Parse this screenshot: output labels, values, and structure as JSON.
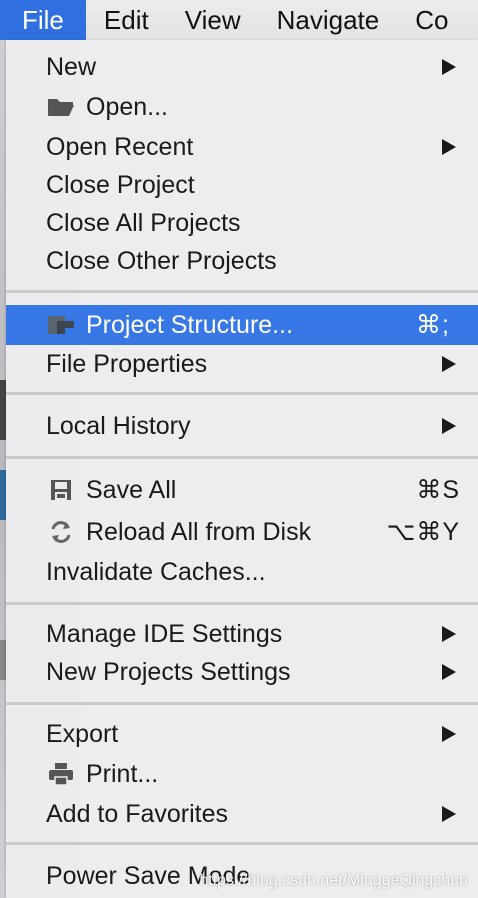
{
  "menubar": {
    "items": [
      "File",
      "Edit",
      "View",
      "Navigate",
      "Co"
    ]
  },
  "menu": {
    "new": "New",
    "open": "Open...",
    "open_recent": "Open Recent",
    "close_project": "Close Project",
    "close_all_projects": "Close All Projects",
    "close_other_projects": "Close Other Projects",
    "project_structure": "Project Structure...",
    "project_structure_shortcut": "⌘;",
    "file_properties": "File Properties",
    "local_history": "Local History",
    "save_all": "Save All",
    "save_all_shortcut": "⌘S",
    "reload_all": "Reload All from Disk",
    "reload_all_shortcut": "⌥⌘Y",
    "invalidate_caches": "Invalidate Caches...",
    "manage_ide_settings": "Manage IDE Settings",
    "new_projects_settings": "New Projects Settings",
    "export": "Export",
    "print": "Print...",
    "add_to_favorites": "Add to Favorites",
    "power_save_mode": "Power Save Mode"
  },
  "icons": {
    "open": "folder-icon",
    "project_structure": "project-structure-icon",
    "save_all": "save-icon",
    "reload_all": "reload-icon",
    "print": "printer-icon",
    "submenu": "submenu-arrow-icon"
  },
  "colors": {
    "menubar_active": "#2f6fe0",
    "highlight": "#3778e6",
    "menu_bg": "#ececee",
    "text": "#1a1a1a"
  },
  "watermark": "https://blog.csdn.net/MinggeQingchun"
}
